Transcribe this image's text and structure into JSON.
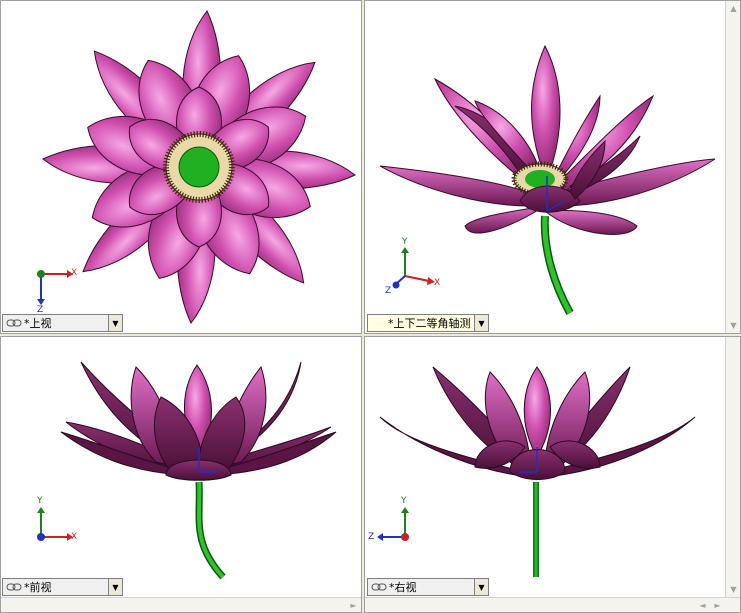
{
  "viewports": {
    "top": {
      "label": "*上视"
    },
    "iso": {
      "label": "*上下二等角轴测"
    },
    "front": {
      "label": "*前视"
    },
    "right": {
      "label": "*右视"
    }
  },
  "axes": {
    "x": "X",
    "y": "Y",
    "z": "Z"
  },
  "colors": {
    "petal": "#d050b0",
    "petal_dark": "#6a1a4a",
    "stem": "#20a020",
    "center": "#20b020",
    "axis_x": "#d02020",
    "axis_y": "#208020",
    "axis_z": "#2030c0"
  },
  "scroll": {
    "up": "▲",
    "down": "▼",
    "left": "◄",
    "right": "►",
    "dropdown": "▼"
  }
}
